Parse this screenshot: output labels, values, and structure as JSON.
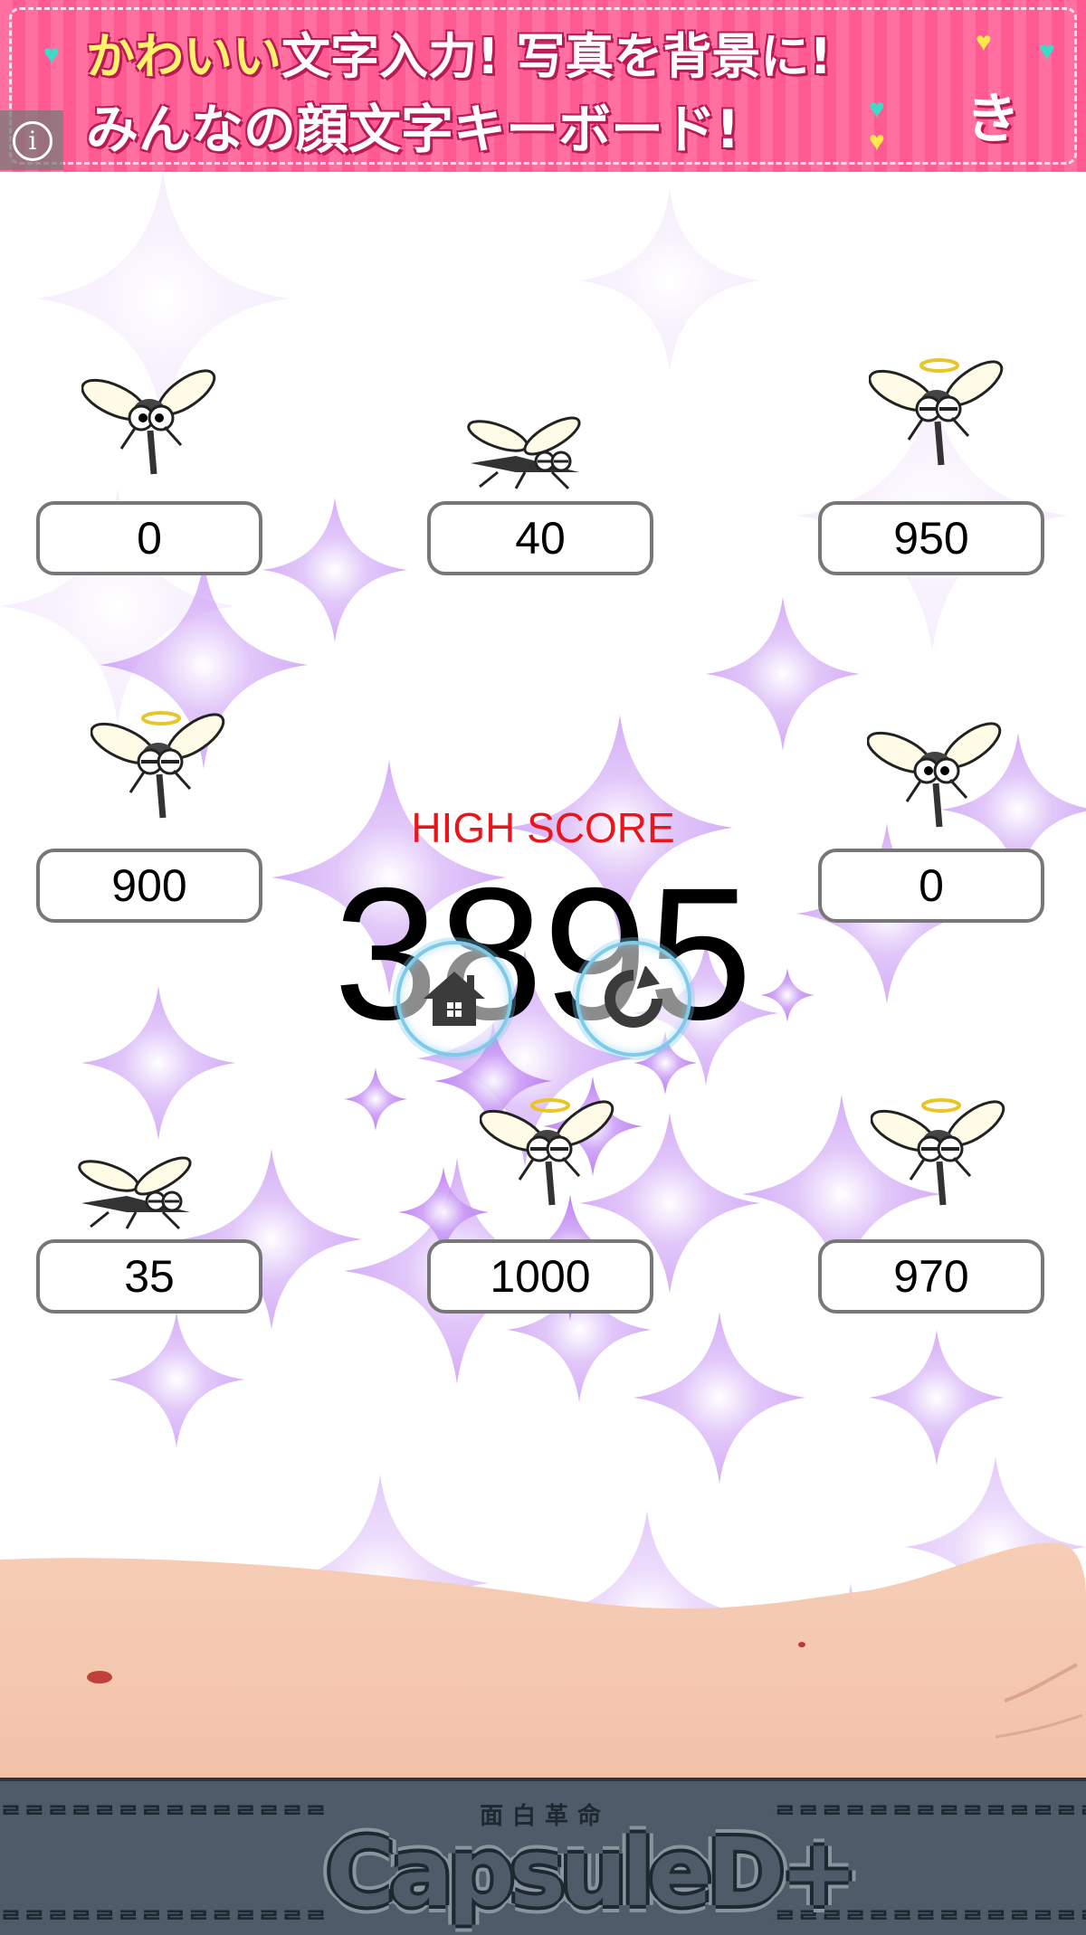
{
  "ad": {
    "line1_highlight": "かわいい",
    "line1_rest": "文字入力! 写真を背景に!",
    "line2": "みんなの顔文字キーボード!",
    "info_icon": "info-icon"
  },
  "game": {
    "high_score_label": "HIGH SCORE",
    "high_score": "3895",
    "scores": [
      "0",
      "40",
      "950",
      "900",
      "0",
      "35",
      "1000",
      "970"
    ],
    "mosquito_states": [
      "alive",
      "squashed",
      "angel",
      "angel",
      "alive",
      "squashed",
      "angel",
      "angel"
    ],
    "buttons": {
      "home_icon": "home-icon",
      "retry_icon": "retry-icon"
    },
    "colors": {
      "high_score_label": "#e8161c",
      "button_ring": "#7ecbe9",
      "sparkle": "#b46cf0"
    }
  },
  "footer": {
    "brand": "CapsuleD+",
    "brand_sub": "面白革命"
  }
}
